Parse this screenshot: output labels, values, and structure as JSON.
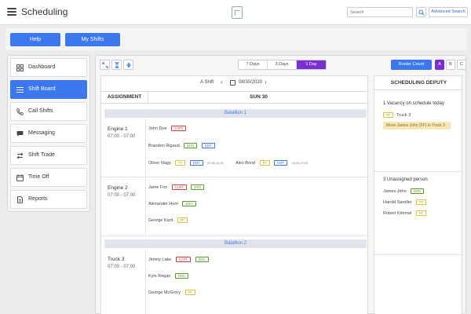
{
  "topbar": {
    "title": "Scheduling",
    "search_placeholder": "Search",
    "advanced_search": "Advanced Search"
  },
  "actions": {
    "help": "Help",
    "my_shifts": "My Shifts"
  },
  "sidebar": {
    "items": [
      {
        "label": "Dashboard",
        "icon": "dashboard-icon",
        "active": false
      },
      {
        "label": "Shift Board",
        "icon": "list-icon",
        "active": true
      },
      {
        "label": "Call Shifts",
        "icon": "phone-icon",
        "active": false
      },
      {
        "label": "Messaging",
        "icon": "chat-icon",
        "active": false
      },
      {
        "label": "Shift Trade",
        "icon": "trade-icon",
        "active": false
      },
      {
        "label": "Time Off",
        "icon": "calendar-icon",
        "active": false
      },
      {
        "label": "Reports",
        "icon": "document-icon",
        "active": false
      }
    ]
  },
  "board": {
    "views": [
      "7 Days",
      "3 Days",
      "1 Day"
    ],
    "active_view": "1 Day",
    "roster_count": "Roster Count",
    "platoons": [
      "A",
      "B",
      "C"
    ],
    "active_platoon": "A",
    "shift_label": "A Shift",
    "date": "08/30/2020",
    "col_assignment": "ASSIGNMENT",
    "col_day": "SUN 30",
    "battalions": [
      {
        "name": "Batallion 1",
        "units": [
          {
            "name": "Engine 1",
            "time": "07:00 - 07:00",
            "people": [
              {
                "name": "John Doe",
                "tags": [
                  {
                    "text": "CAPT",
                    "color": "red"
                  }
                ]
              },
              {
                "name": "Brandon Rigaud",
                "tags": [
                  {
                    "text": "ENG",
                    "color": "green"
                  },
                  {
                    "text": "EMT",
                    "color": "blue"
                  }
                ]
              },
              {
                "name": "Oliver Nagy",
                "tags": [
                  {
                    "text": "FF",
                    "color": "yellow"
                  },
                  {
                    "text": "EMT",
                    "color": "blue"
                  }
                ],
                "note": "07:00-10:00"
              },
              {
                "name": "Alex Bond",
                "tags": [
                  {
                    "text": "FF",
                    "color": "yellow"
                  },
                  {
                    "text": "EMT",
                    "color": "blue"
                  }
                ],
                "note": "10:00-07:00"
              }
            ]
          },
          {
            "name": "Engine 2",
            "time": "07:00 - 07:00",
            "people": [
              {
                "name": "Jame Fox",
                "tags": [
                  {
                    "text": "CAPT",
                    "color": "red"
                  },
                  {
                    "text": "ENG",
                    "color": "green"
                  }
                ]
              },
              {
                "name": "Alexander Hunt",
                "tags": [
                  {
                    "text": "ENG",
                    "color": "green"
                  }
                ]
              },
              {
                "name": "George Kant",
                "tags": [
                  {
                    "text": "FF",
                    "color": "yellow"
                  }
                ]
              }
            ]
          }
        ]
      },
      {
        "name": "Batallion 2",
        "units": [
          {
            "name": "Truck 3",
            "time": "07:00 - 07:00",
            "people": [
              {
                "name": "Jimmy Lake",
                "tags": [
                  {
                    "text": "CAPT",
                    "color": "red"
                  },
                  {
                    "text": "ENG",
                    "color": "green"
                  }
                ]
              },
              {
                "name": "Kyle Regan",
                "tags": [
                  {
                    "text": "ENG",
                    "color": "green"
                  }
                ]
              },
              {
                "name": "George McGrory",
                "tags": [
                  {
                    "text": "FF",
                    "color": "yellow"
                  }
                ]
              }
            ]
          }
        ]
      }
    ]
  },
  "deputy": {
    "title": "SCHEDULING DEPUTY",
    "vacancy_header": "1 Vacancy on schedule today",
    "vacancy_tag": "FF",
    "vacancy_unit": "Truck 3",
    "vacancy_note": "Move James John (FF) to Truck 3",
    "unassigned_header": "3 Unassigned person",
    "unassigned": [
      {
        "name": "James John",
        "tag": {
          "text": "ENG",
          "color": "green"
        }
      },
      {
        "name": "Harold Sandler",
        "tag": {
          "text": "FF",
          "color": "yellow"
        }
      },
      {
        "name": "Robert Kimmel",
        "tag": {
          "text": "FF",
          "color": "yellow"
        }
      }
    ]
  }
}
